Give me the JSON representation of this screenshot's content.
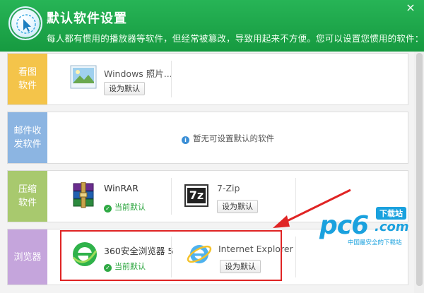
{
  "header": {
    "title": "默认软件设置",
    "subtitle": "每人都有惯用的播放器等软件，但经常被篡改，导致用起来不方便。您可以设置您惯用的软件：",
    "close": "×"
  },
  "rows": {
    "image": {
      "category": "看图\n软件",
      "apps": [
        {
          "name": "Windows 照片...",
          "button": "设为默认"
        }
      ]
    },
    "mail": {
      "category": "邮件收\n发软件",
      "empty_text": "暂无可设置默认的软件",
      "info_icon": "i"
    },
    "compress": {
      "category": "压缩\n软件",
      "apps": [
        {
          "name": "WinRAR",
          "status": "当前默认"
        },
        {
          "name": "7-Zip",
          "button": "设为默认",
          "icon_text": "7z"
        }
      ]
    },
    "browser": {
      "category": "浏览器",
      "apps": [
        {
          "name": "360安全浏览器 5",
          "status": "当前默认"
        },
        {
          "name": "Internet Explorer",
          "button": "设为默认"
        }
      ]
    }
  },
  "check_glyph": "✓",
  "watermark": {
    "brand": "pc6",
    "tag": "下载站",
    "domain": ".com",
    "slogan": "中国最安全的下载站"
  },
  "colors": {
    "header_green": "#1fa84b",
    "cat_image": "#f4c44a",
    "cat_mail": "#8cb5e2",
    "cat_compress": "#a8c96e",
    "cat_browser": "#c5a5dc",
    "highlight_red": "#e02424",
    "watermark_blue": "#1aa1de"
  }
}
